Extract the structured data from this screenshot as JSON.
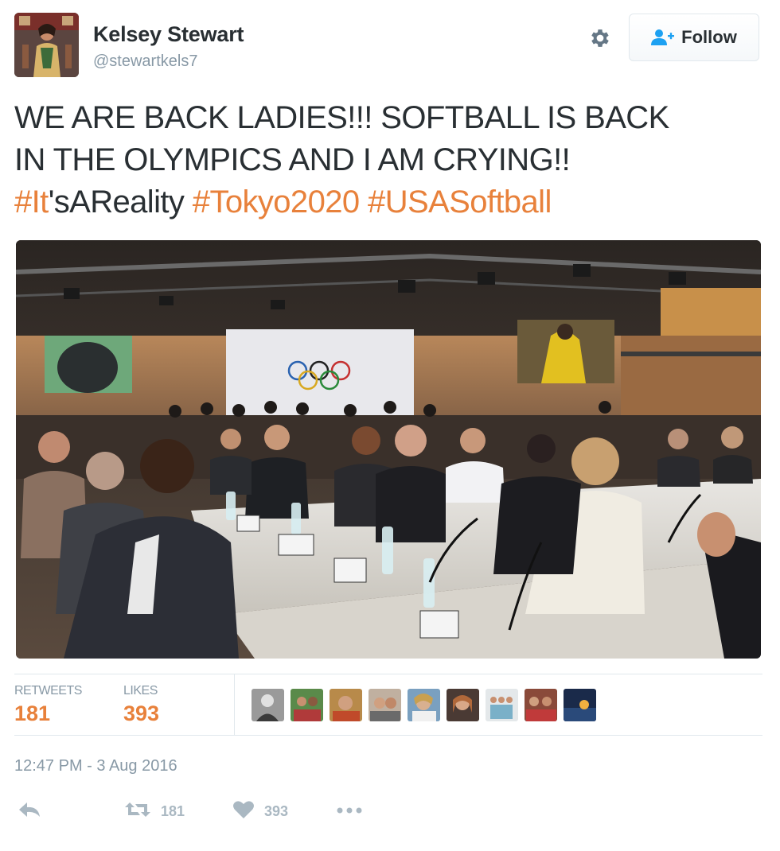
{
  "user": {
    "name": "Kelsey Stewart",
    "handle": "@stewartkels7"
  },
  "follow": {
    "label": "Follow"
  },
  "tweet": {
    "line1": "WE ARE BACK LADIES!!! SOFTBALL IS BACK",
    "line2": "IN THE OLYMPICS AND I AM CRYING!!",
    "hashtag1_link": "#It",
    "hashtag1_rest": "'sAReality",
    "hashtag2": "#Tokyo2020",
    "hashtag3": "#USASoftball"
  },
  "stats": {
    "retweets_label": "RETWEETS",
    "retweets_value": "181",
    "likes_label": "LIKES",
    "likes_value": "393"
  },
  "timestamp": "12:47 PM - 3 Aug 2016",
  "actions": {
    "retweet_count": "181",
    "like_count": "393"
  },
  "icons": {
    "settings": "gear-icon",
    "follow": "add-user-icon",
    "reply": "reply-icon",
    "retweet": "retweet-icon",
    "like": "heart-icon",
    "more": "more-icon"
  },
  "colors": {
    "accent": "#e8813b",
    "muted": "#8899a6",
    "text": "#292f33",
    "follow_icon": "#1da1f2"
  }
}
